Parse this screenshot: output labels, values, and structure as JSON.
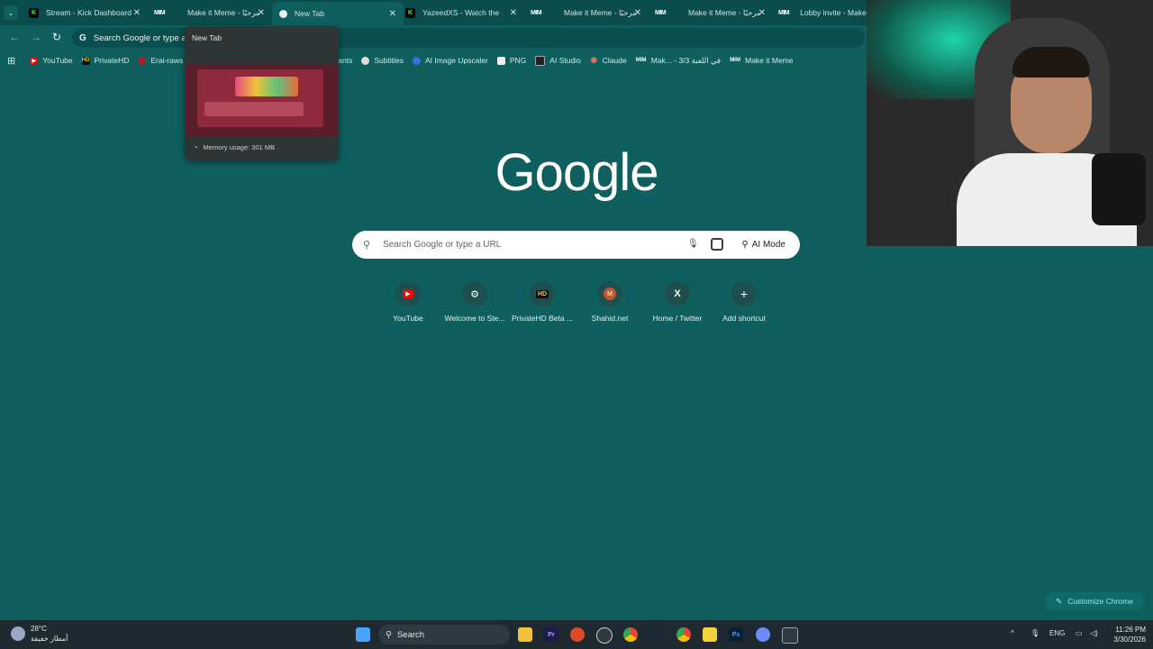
{
  "tabs": [
    {
      "title": "Stream - Kick Dashboard",
      "icon": "kick-icon",
      "active": false
    },
    {
      "title": "Make it Meme - مرحبًا",
      "icon": "mim-icon",
      "active": false
    },
    {
      "title": "New Tab",
      "icon": "google-icon",
      "active": true
    },
    {
      "title": "YazeedXS - Watch the",
      "icon": "kick-icon",
      "active": false
    },
    {
      "title": "Make it Meme - مرحبًا",
      "icon": "mim-icon",
      "active": false
    },
    {
      "title": "Make it Meme - مرحبًا",
      "icon": "mim-icon",
      "active": false
    },
    {
      "title": "Lobby invite - Make it M",
      "icon": "mim-icon",
      "active": false
    }
  ],
  "omnibox": {
    "text": "Search Google or type a"
  },
  "bookmarks": [
    {
      "label": "YouTube",
      "icon": "youtube-icon"
    },
    {
      "label": "PrivateHD",
      "icon": "hd-icon"
    },
    {
      "label": "Erai-raws",
      "icon": "erai-icon"
    },
    {
      "label": "ants",
      "icon": "none"
    },
    {
      "label": "Subtitles",
      "icon": "subtitles-icon"
    },
    {
      "label": "AI Image Upscaler",
      "icon": "upscaler-icon"
    },
    {
      "label": "PNG",
      "icon": "png-icon"
    },
    {
      "label": "AI Studio",
      "icon": "aistudio-icon"
    },
    {
      "label": "Claude",
      "icon": "claude-icon"
    },
    {
      "label": "Mak... - في اللعبة 3/3",
      "icon": "mim-icon"
    },
    {
      "label": "Make it Meme",
      "icon": "mim-icon"
    }
  ],
  "hovercard": {
    "title": "New Tab",
    "memory": "Memory usage: 301 MB"
  },
  "google": {
    "logo": "Google",
    "placeholder": "Search Google or type a URL",
    "ai_mode": "AI Mode"
  },
  "shortcuts": [
    {
      "label": "YouTube",
      "icon": "youtube-icon",
      "glyph": "▶"
    },
    {
      "label": "Welcome to Ste...",
      "icon": "steam-icon",
      "glyph": "⚙"
    },
    {
      "label": "PrivateHD Beta ...",
      "icon": "hd-icon",
      "glyph": "HD"
    },
    {
      "label": "Shahid.net",
      "icon": "shahid-icon",
      "glyph": "M"
    },
    {
      "label": "Home / Twitter",
      "icon": "x-icon",
      "glyph": "X"
    },
    {
      "label": "Add shortcut",
      "icon": "plus-icon",
      "glyph": "+"
    }
  ],
  "customize": {
    "label": "Customize Chrome"
  },
  "taskbar": {
    "weather_temp": "28°C",
    "weather_desc": "أمطار خفيفة",
    "search": "Search",
    "language": "ENG",
    "time": "11:26 PM",
    "date": "3/30/2026"
  },
  "colors": {
    "background": "#0f5f5f",
    "tabstrip": "#0b4d4d",
    "taskbar": "#1f2a30"
  }
}
